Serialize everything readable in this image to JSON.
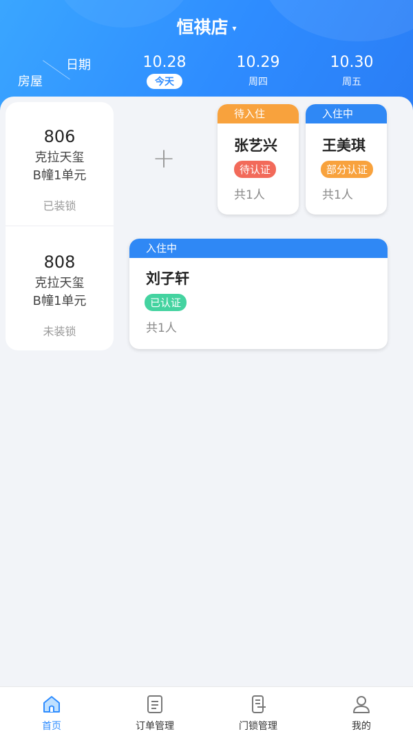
{
  "header": {
    "store_name": "恒祺店",
    "caret": "▾",
    "corner_date": "日期",
    "corner_room": "房屋",
    "dates": [
      {
        "date": "10.28",
        "weekday": "今天",
        "is_today": true
      },
      {
        "date": "10.29",
        "weekday": "周四",
        "is_today": false
      },
      {
        "date": "10.30",
        "weekday": "周五",
        "is_today": false
      }
    ]
  },
  "rooms": [
    {
      "number": "806",
      "community": "克拉天玺",
      "unit": "B幢1单元",
      "lock_status": "已装锁"
    },
    {
      "number": "808",
      "community": "克拉天玺",
      "unit": "B幢1单元",
      "lock_status": "未装锁"
    }
  ],
  "add_button": "+",
  "bookings": [
    {
      "status": "待入住",
      "status_color": "#f8a23d",
      "guest": "张艺兴",
      "verify": "待认证",
      "verify_color": "#f26a5a",
      "count": "共1人"
    },
    {
      "status": "入住中",
      "status_color": "#2f88f5",
      "guest": "王美琪",
      "verify": "部分认证",
      "verify_color": "#f8a23d",
      "count": "共1人"
    },
    {
      "status": "入住中",
      "status_color": "#2f88f5",
      "guest": "刘子轩",
      "verify": "已认证",
      "verify_color": "#44d3a0",
      "count": "共1人"
    }
  ],
  "nav": [
    {
      "label": "首页",
      "icon": "home-icon",
      "active": true
    },
    {
      "label": "订单管理",
      "icon": "order-icon",
      "active": false
    },
    {
      "label": "门锁管理",
      "icon": "door-lock-icon",
      "active": false
    },
    {
      "label": "我的",
      "icon": "profile-icon",
      "active": false
    }
  ],
  "colors": {
    "primary": "#2e8cff",
    "background": "#f2f4f8"
  }
}
